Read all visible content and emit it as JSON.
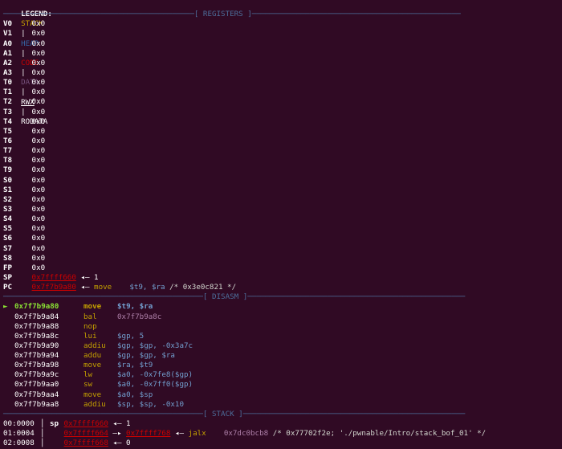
{
  "legend": {
    "label": "LEGEND:",
    "items": [
      {
        "text": "STACK"
      },
      {
        "text": "HEAP"
      },
      {
        "text": "CODE"
      },
      {
        "text": "DATA"
      },
      {
        "text": "RWX"
      },
      {
        "text": "RODATA"
      }
    ],
    "sep": "|"
  },
  "sections": {
    "registers": "[ REGISTERS ]",
    "disasm": "[ DISASM ]",
    "stack": "[ STACK ]"
  },
  "registers": [
    {
      "name": "V0",
      "value": "0x0"
    },
    {
      "name": "V1",
      "value": "0x0"
    },
    {
      "name": "A0",
      "value": "0x0"
    },
    {
      "name": "A1",
      "value": "0x0"
    },
    {
      "name": "A2",
      "value": "0x0"
    },
    {
      "name": "A3",
      "value": "0x0"
    },
    {
      "name": "T0",
      "value": "0x0"
    },
    {
      "name": "T1",
      "value": "0x0"
    },
    {
      "name": "T2",
      "value": "0x0"
    },
    {
      "name": "T3",
      "value": "0x0"
    },
    {
      "name": "T4",
      "value": "0x0"
    },
    {
      "name": "T5",
      "value": "0x0"
    },
    {
      "name": "T6",
      "value": "0x0"
    },
    {
      "name": "T7",
      "value": "0x0"
    },
    {
      "name": "T8",
      "value": "0x0"
    },
    {
      "name": "T9",
      "value": "0x0"
    },
    {
      "name": "S0",
      "value": "0x0"
    },
    {
      "name": "S1",
      "value": "0x0"
    },
    {
      "name": "S2",
      "value": "0x0"
    },
    {
      "name": "S3",
      "value": "0x0"
    },
    {
      "name": "S4",
      "value": "0x0"
    },
    {
      "name": "S5",
      "value": "0x0"
    },
    {
      "name": "S6",
      "value": "0x0"
    },
    {
      "name": "S7",
      "value": "0x0"
    },
    {
      "name": "S8",
      "value": "0x0"
    },
    {
      "name": "FP",
      "value": "0x0"
    }
  ],
  "sp": {
    "name": "SP",
    "addr": "0x7ffff660",
    "arrow": "◂—",
    "value": "1"
  },
  "pc": {
    "name": "PC",
    "addr": "0x7f7b9a80",
    "arrow": "◂—",
    "mnemonic": "move",
    "operands": "$t9, $ra",
    "comment": "/* 0x3e0c821 */"
  },
  "disasm": [
    {
      "marker": "►",
      "addr": "0x7f7b9a80",
      "mn": "move",
      "ops": "$t9, $ra",
      "current": true
    },
    {
      "marker": "",
      "addr": "0x7f7b9a84",
      "mn": "bal",
      "ops": "0x7f7b9a8c"
    },
    {
      "marker": "",
      "addr": "0x7f7b9a88",
      "mn": "nop",
      "ops": ""
    },
    {
      "marker": "",
      "addr": "0x7f7b9a8c",
      "mn": "lui",
      "ops": "$gp, 5"
    },
    {
      "marker": "",
      "addr": "0x7f7b9a90",
      "mn": "addiu",
      "ops": "$gp, $gp, -0x3a7c"
    },
    {
      "marker": "",
      "addr": "0x7f7b9a94",
      "mn": "addu",
      "ops": "$gp, $gp, $ra"
    },
    {
      "marker": "",
      "addr": "0x7f7b9a98",
      "mn": "move",
      "ops": "$ra, $t9"
    },
    {
      "marker": "",
      "addr": "0x7f7b9a9c",
      "mn": "lw",
      "ops": "$a0, -0x7fe8($gp)"
    },
    {
      "marker": "",
      "addr": "0x7f7b9aa0",
      "mn": "sw",
      "ops": "$a0, -0x7ff0($gp)"
    },
    {
      "marker": "",
      "addr": "0x7f7b9aa4",
      "mn": "move",
      "ops": "$a0, $sp"
    },
    {
      "marker": "",
      "addr": "0x7f7b9aa8",
      "mn": "addiu",
      "ops": "$sp, $sp, -0x10"
    }
  ],
  "stack": [
    {
      "idx": "00:0000",
      "reg": "sp",
      "addr": "0x7ffff660",
      "arrow": "◂—",
      "value": "1"
    },
    {
      "idx": "01:0004",
      "reg": "",
      "addr": "0x7ffff664",
      "arrow": "—▸",
      "ptr": "0x7ffff768",
      "arrow2": "◂—",
      "mn": "jalx",
      "target": "0x7dc0bcb8",
      "comment": "/* 0x77702f2e; './pwnable/Intro/stack_bof_01' */"
    },
    {
      "idx": "02:0008",
      "reg": "",
      "addr": "0x7ffff668",
      "arrow": "◂—",
      "value": "0"
    }
  ]
}
